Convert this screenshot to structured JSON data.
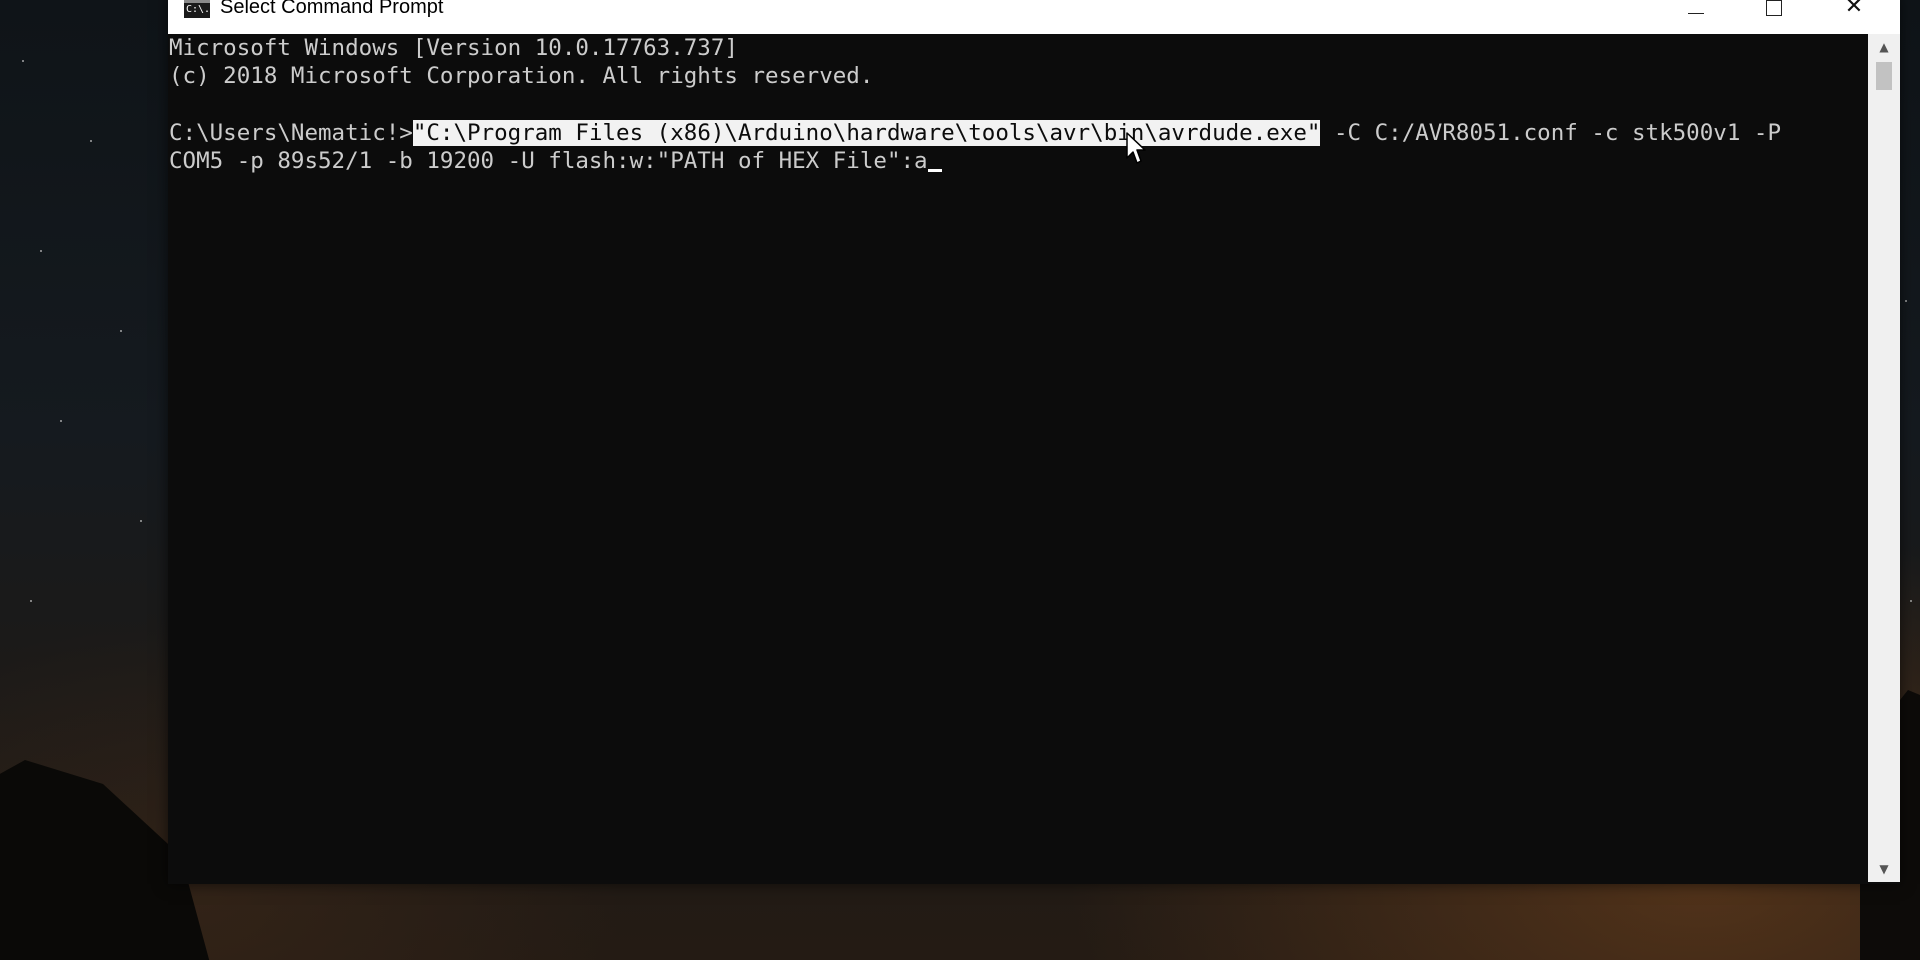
{
  "window": {
    "title": "Select Command Prompt",
    "icon_text": "C:\\.",
    "icon": "cmd-icon"
  },
  "caption_buttons": {
    "minimize": "minimize-icon",
    "maximize": "maximize-icon",
    "close": "close-icon"
  },
  "console": {
    "lines": [
      "Microsoft Windows [Version 10.0.17763.737]",
      "(c) 2018 Microsoft Corporation. All rights reserved.",
      ""
    ],
    "prompt": "C:\\Users\\Nematic!>",
    "selected_text": "\"C:\\Program Files (x86)\\Arduino\\hardware\\tools\\avr\\bin\\avrdude.exe\"",
    "command_rest": " -C C:/AVR8051.conf -c stk500v1 -P",
    "command_line2": "COM5 -p 89s52/1 -b 19200 -U flash:w:\"PATH of HEX File\":a"
  },
  "colors": {
    "console_bg": "#0c0c0c",
    "console_text": "#cccccc",
    "selection_bg": "#f2f2f2",
    "titlebar_bg": "#ffffff"
  }
}
